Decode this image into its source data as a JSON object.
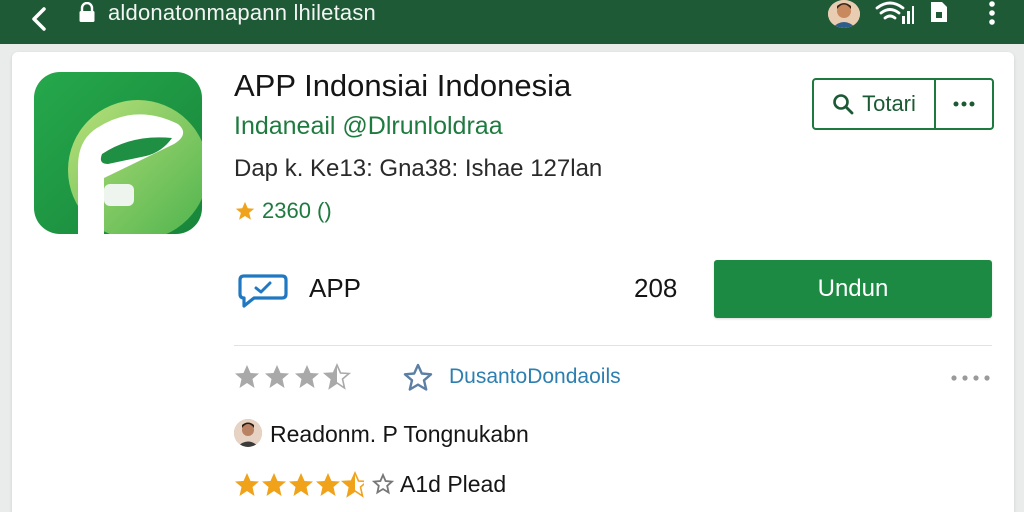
{
  "topbar": {
    "url": "aldonatonmapann lhiletasn",
    "background": "#1f5a37"
  },
  "app": {
    "title": "APP Indonsiai Indonesia",
    "developer": "Indaneail @Dlrunloldraa",
    "meta": "Dap k. Ke13: Gna38: Ishae 127lan",
    "rating": "2360 ()",
    "rating_stars": 1,
    "icon_color": "#1e9a47"
  },
  "actions": {
    "total_label": "Totari",
    "more_icon": "more-horizontal-icon"
  },
  "install": {
    "type_label": "APP",
    "size": "208",
    "download_label": "Undun",
    "accent": "#1c8a43"
  },
  "review_section": {
    "grey_rating": 3.5,
    "wishlist_label": "DusantoDondaoils",
    "reviewer_name": "Readonm. P Tongnukabn",
    "review_rating": 4.5,
    "review_tag": "A1d Plead"
  }
}
